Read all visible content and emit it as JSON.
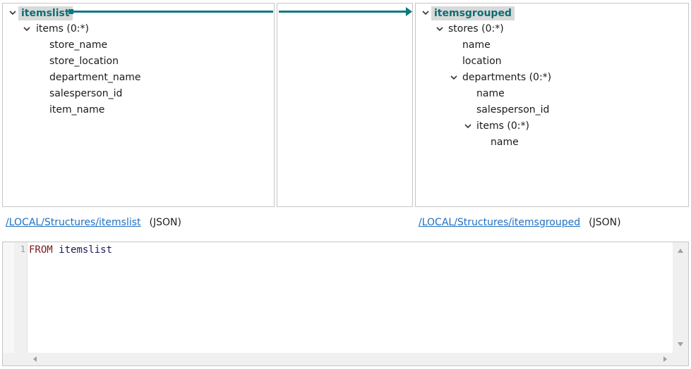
{
  "source": {
    "root_label": "itemslist",
    "nodes": [
      {
        "label": "items (0:*)",
        "expanded": true
      },
      {
        "label": "store_name"
      },
      {
        "label": "store_location"
      },
      {
        "label": "department_name"
      },
      {
        "label": "salesperson_id"
      },
      {
        "label": "item_name"
      }
    ],
    "path_link": "/LOCAL/Structures/itemslist",
    "path_type": "(JSON)"
  },
  "target": {
    "root_label": "itemsgrouped",
    "nodes": [
      {
        "label": "stores (0:*)",
        "expanded": true
      },
      {
        "label": "name"
      },
      {
        "label": "location"
      },
      {
        "label": "departments (0:*)",
        "expanded": true
      },
      {
        "label": "name"
      },
      {
        "label": "salesperson_id"
      },
      {
        "label": "items (0:*)",
        "expanded": true
      },
      {
        "label": "name"
      }
    ],
    "path_link": "/LOCAL/Structures/itemsgrouped",
    "path_type": "(JSON)"
  },
  "editor": {
    "line_number": "1",
    "keyword": "FROM",
    "identifier": "itemslist"
  },
  "icons": {
    "expand": "chevron-down-icon",
    "scroll_up": "triangle-up-icon",
    "scroll_down": "triangle-down-icon",
    "scroll_left": "triangle-left-icon",
    "scroll_right": "triangle-right-icon"
  },
  "colors": {
    "connector": "#0b7a7d",
    "root_label_text": "#0b6e74",
    "root_label_bg": "#d9d9d9",
    "link": "#1f6fc0",
    "keyword": "#7a1a1a"
  }
}
